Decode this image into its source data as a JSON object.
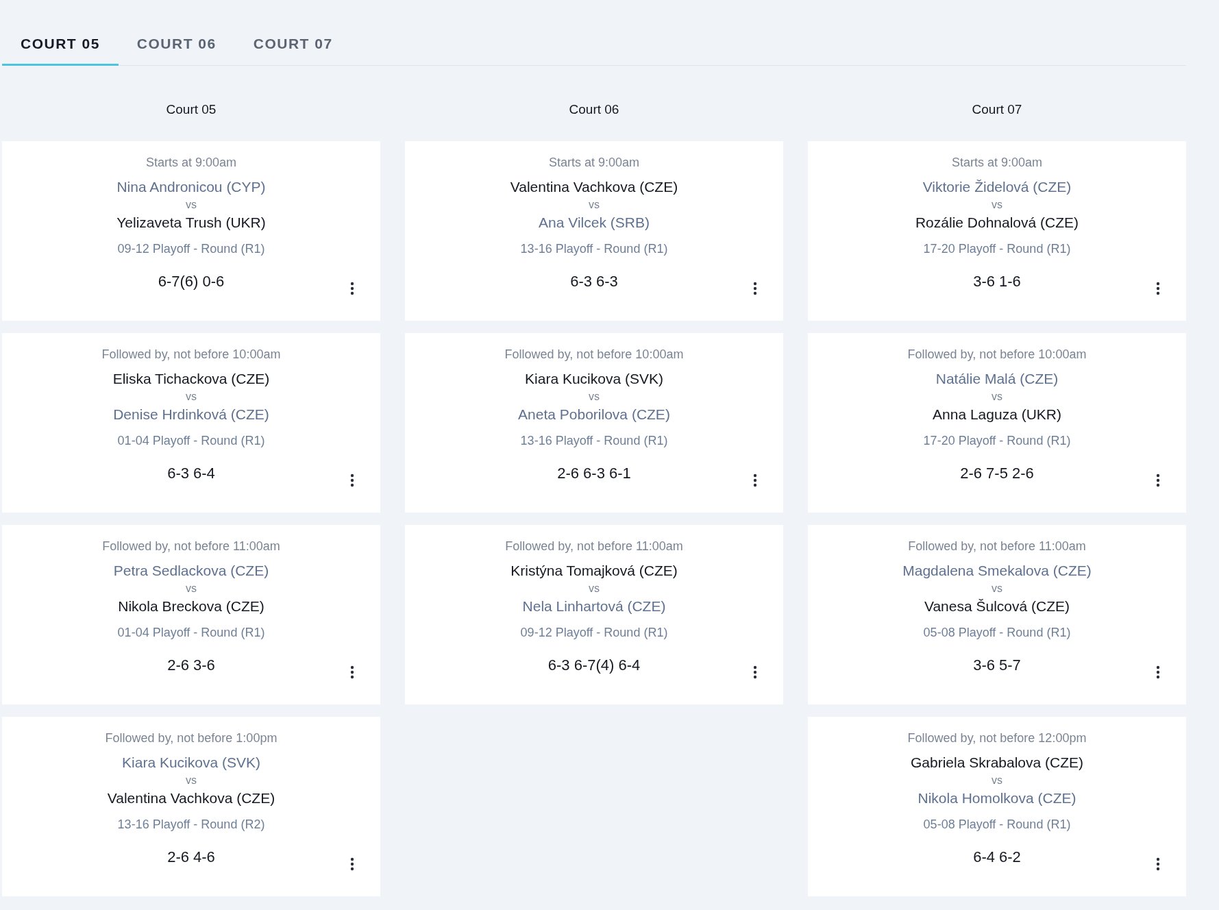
{
  "tabs": [
    {
      "label": "COURT 05",
      "selected": true
    },
    {
      "label": "COURT 06",
      "selected": false
    },
    {
      "label": "COURT 07",
      "selected": false
    }
  ],
  "columns": [
    {
      "heading": "Court 05",
      "matches": [
        {
          "time": "Starts at 9:00am",
          "players": [
            {
              "name": "Nina Andronicou (CYP)",
              "winner": false
            },
            {
              "name": "Yelizaveta Trush (UKR)",
              "winner": true
            }
          ],
          "vs": "vs",
          "round": "09-12 Playoff - Round (R1)",
          "score": "6-7(6) 0-6"
        },
        {
          "time": "Followed by, not before 10:00am",
          "players": [
            {
              "name": "Eliska Tichackova (CZE)",
              "winner": true
            },
            {
              "name": "Denise Hrdinková (CZE)",
              "winner": false
            }
          ],
          "vs": "vs",
          "round": "01-04 Playoff - Round (R1)",
          "score": "6-3 6-4"
        },
        {
          "time": "Followed by, not before 11:00am",
          "players": [
            {
              "name": "Petra Sedlackova (CZE)",
              "winner": false
            },
            {
              "name": "Nikola Breckova (CZE)",
              "winner": true
            }
          ],
          "vs": "vs",
          "round": "01-04 Playoff - Round (R1)",
          "score": "2-6 3-6"
        },
        {
          "time": "Followed by, not before 1:00pm",
          "players": [
            {
              "name": "Kiara Kucikova (SVK)",
              "winner": false
            },
            {
              "name": "Valentina Vachkova (CZE)",
              "winner": true
            }
          ],
          "vs": "vs",
          "round": "13-16 Playoff - Round (R2)",
          "score": "2-6 4-6"
        }
      ]
    },
    {
      "heading": "Court 06",
      "matches": [
        {
          "time": "Starts at 9:00am",
          "players": [
            {
              "name": "Valentina Vachkova (CZE)",
              "winner": true
            },
            {
              "name": "Ana Vilcek (SRB)",
              "winner": false
            }
          ],
          "vs": "vs",
          "round": "13-16 Playoff - Round (R1)",
          "score": "6-3 6-3"
        },
        {
          "time": "Followed by, not before 10:00am",
          "players": [
            {
              "name": "Kiara Kucikova (SVK)",
              "winner": true
            },
            {
              "name": "Aneta Poborilova (CZE)",
              "winner": false
            }
          ],
          "vs": "vs",
          "round": "13-16 Playoff - Round (R1)",
          "score": "2-6 6-3 6-1"
        },
        {
          "time": "Followed by, not before 11:00am",
          "players": [
            {
              "name": "Kristýna Tomajková (CZE)",
              "winner": true
            },
            {
              "name": "Nela Linhartová (CZE)",
              "winner": false
            }
          ],
          "vs": "vs",
          "round": "09-12 Playoff - Round (R1)",
          "score": "6-3 6-7(4) 6-4"
        }
      ]
    },
    {
      "heading": "Court 07",
      "matches": [
        {
          "time": "Starts at 9:00am",
          "players": [
            {
              "name": "Viktorie Židelová (CZE)",
              "winner": false
            },
            {
              "name": "Rozálie Dohnalová (CZE)",
              "winner": true
            }
          ],
          "vs": "vs",
          "round": "17-20 Playoff - Round (R1)",
          "score": "3-6 1-6"
        },
        {
          "time": "Followed by, not before 10:00am",
          "players": [
            {
              "name": "Natálie Malá (CZE)",
              "winner": false
            },
            {
              "name": "Anna Laguza (UKR)",
              "winner": true
            }
          ],
          "vs": "vs",
          "round": "17-20 Playoff - Round (R1)",
          "score": "2-6 7-5 2-6"
        },
        {
          "time": "Followed by, not before 11:00am",
          "players": [
            {
              "name": "Magdalena Smekalova (CZE)",
              "winner": false
            },
            {
              "name": "Vanesa Šulcová (CZE)",
              "winner": true
            }
          ],
          "vs": "vs",
          "round": "05-08 Playoff - Round (R1)",
          "score": "3-6 5-7"
        },
        {
          "time": "Followed by, not before 12:00pm",
          "players": [
            {
              "name": "Gabriela Skrabalova (CZE)",
              "winner": true
            },
            {
              "name": "Nikola Homolkova (CZE)",
              "winner": false
            }
          ],
          "vs": "vs",
          "round": "05-08 Playoff - Round (R1)",
          "score": "6-4 6-2"
        }
      ]
    }
  ]
}
